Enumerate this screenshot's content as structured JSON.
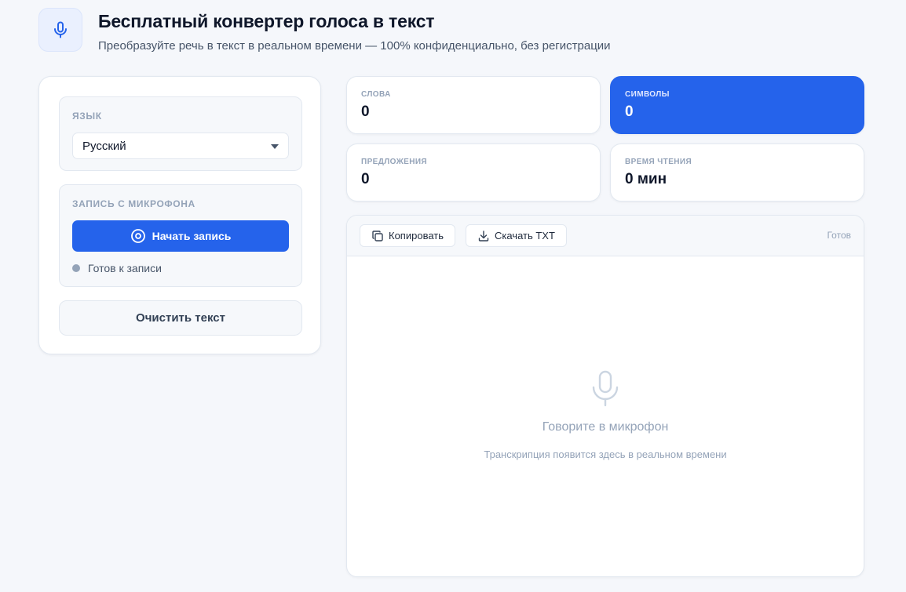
{
  "header": {
    "title": "Бесплатный конвертер голоса в текст",
    "subtitle": "Преобразуйте речь в текст в реальном времени — 100% конфиденциально, без регистрации",
    "icon": "microphone-icon"
  },
  "sidebar": {
    "language": {
      "label": "ЯЗЫК",
      "selected": "Русский"
    },
    "microphone": {
      "label": "ЗАПИСЬ С МИКРОФОНА",
      "record_button": "Начать запись",
      "status": "Готов к записи"
    },
    "clear_button": "Очистить текст"
  },
  "stats": {
    "words": {
      "label": "СЛОВА",
      "value": "0"
    },
    "characters": {
      "label": "СИМВОЛЫ",
      "value": "0"
    },
    "sentences": {
      "label": "ПРЕДЛОЖЕНИЯ",
      "value": "0"
    },
    "reading_time": {
      "label": "ВРЕМЯ ЧТЕНИЯ",
      "value": "0 мин"
    }
  },
  "editor": {
    "copy_button": "Копировать",
    "download_button": "Скачать TXT",
    "status": "Готов",
    "empty_title": "Говорите в микрофон",
    "empty_subtitle": "Транскрипция появится здесь в реальном времени"
  },
  "colors": {
    "accent": "#2563eb",
    "background": "#f5f7fb",
    "muted": "#94a3b8"
  }
}
